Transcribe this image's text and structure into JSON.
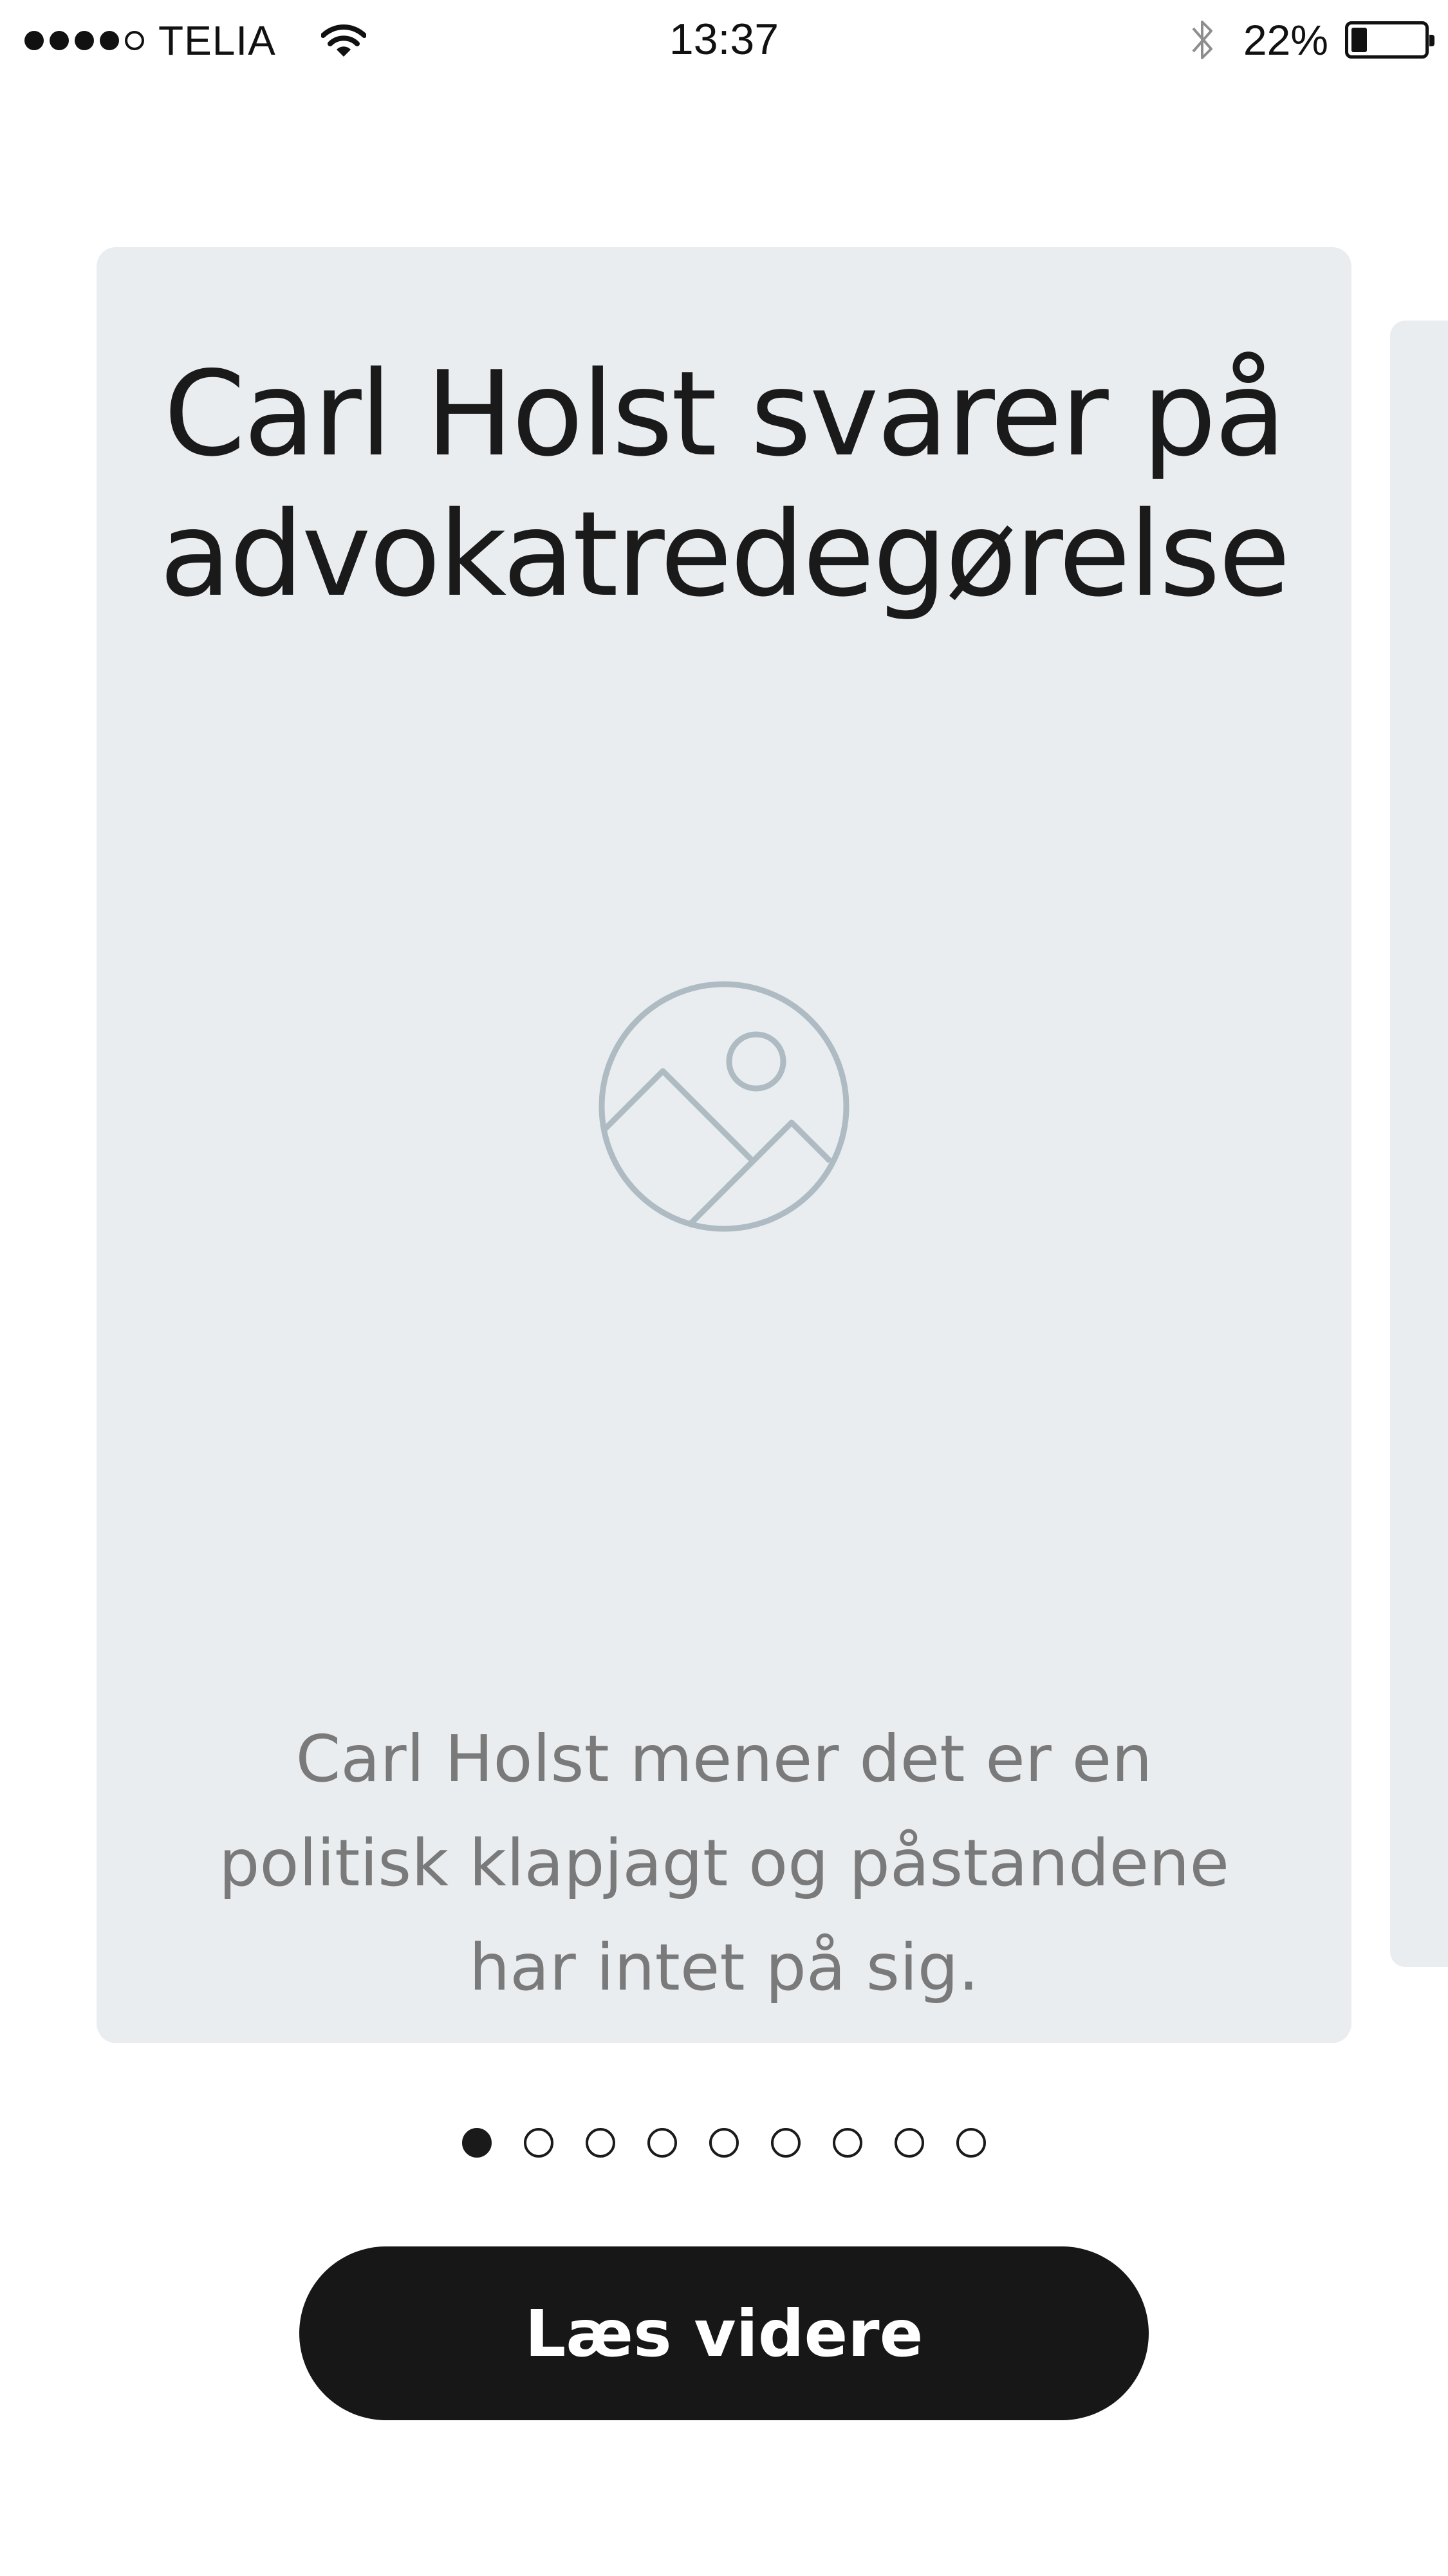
{
  "status_bar": {
    "signal_bars_filled": 4,
    "signal_bars_total": 5,
    "carrier": "TELIA",
    "wifi_icon": "wifi-icon",
    "time": "13:37",
    "bluetooth_icon": "bluetooth-icon",
    "battery_percent": "22%",
    "battery_level": 0.22
  },
  "carousel": {
    "current_card": {
      "title": "Carl Holst svarer på advokatredegørelse",
      "image_icon": "image-placeholder-icon",
      "summary": "Carl Holst mener det er en politisk klapjagt og påstandene har intet på sig."
    },
    "page_count": 9,
    "active_page": 1
  },
  "actions": {
    "read_more_label": "Læs videre"
  },
  "colors": {
    "card_background": "#e9edf0",
    "placeholder_icon": "#aebbc2",
    "button_background": "#171717",
    "button_text": "#ffffff",
    "summary_text": "#7a7a7a"
  }
}
